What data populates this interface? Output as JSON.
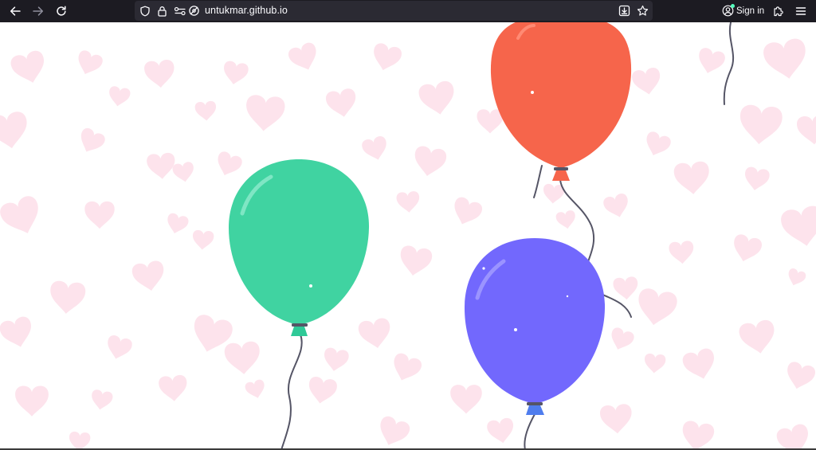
{
  "browser": {
    "url": "untukmar.github.io",
    "sign_in_label": "Sign in",
    "icons": {
      "back": "arrow-left-icon",
      "forward": "arrow-right-icon",
      "reload": "reload-icon",
      "shield": "shield-icon",
      "lock": "lock-icon",
      "permissions": "permissions-icon",
      "tracking": "eye-off-icon",
      "save": "download-icon",
      "bookmark": "star-icon",
      "account": "account-icon",
      "extensions": "puzzle-icon",
      "menu": "hamburger-menu-icon"
    },
    "colors": {
      "toolbar": "#1c1b22",
      "urlbar": "#2b2a33",
      "text": "#fbfbfe"
    }
  },
  "page": {
    "background": "#ffffff",
    "heart_color": "#fde3ec",
    "string_color": "#555566",
    "balloons": [
      {
        "name": "red-balloon",
        "color": "#f6654b",
        "knot": "#f6654b"
      },
      {
        "name": "green-balloon",
        "color": "#40d3a1",
        "knot": "#2fc997"
      },
      {
        "name": "purple-balloon",
        "color": "#7268fd",
        "knot": "#4f7dee"
      }
    ]
  }
}
